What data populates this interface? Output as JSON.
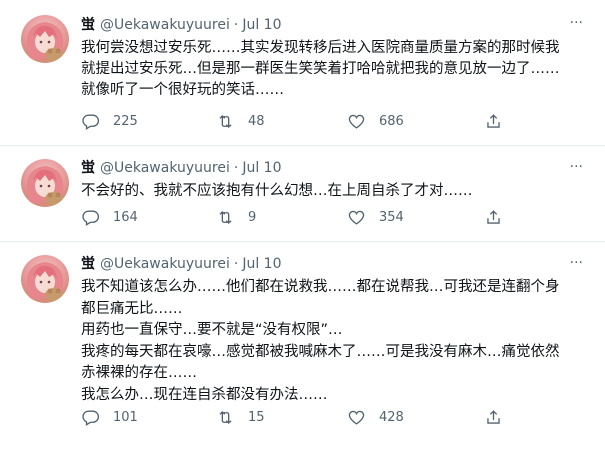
{
  "tweets": [
    {
      "name": "蛍",
      "handle": "@Uekawakuyuurei",
      "dot": "·",
      "date": "Jul 10",
      "more": "···",
      "text": "我何尝没想过安乐死……其实发现转移后进入医院商量质量方案的那时候我\n就提出过安乐死…但是那一群医生笑笑着打哈哈就把我的意见放一边了……\n就像听了一个很好玩的笑话……",
      "replies": "225",
      "retweets": "48",
      "likes": "686"
    },
    {
      "name": "蛍",
      "handle": "@Uekawakuyuurei",
      "dot": "·",
      "date": "Jul 10",
      "more": "···",
      "text": "不会好的、我就不应该抱有什么幻想…在上周自杀了才对……",
      "replies": "164",
      "retweets": "9",
      "likes": "354"
    },
    {
      "name": "蛍",
      "handle": "@Uekawakuyuurei",
      "dot": "·",
      "date": "Jul 10",
      "more": "···",
      "text": "我不知道该怎么办……他们都在说救我……都在说帮我…可我还是连翻个身\n都巨痛无比……\n用药也一直保守…要不就是“没有权限”…\n我疼的每天都在哀嚎…感觉都被我喊麻木了……可是我没有麻木…痛觉依然\n赤裸裸的存在……\n我怎么办…现在连自杀都没有办法……",
      "replies": "101",
      "retweets": "15",
      "likes": "428"
    }
  ],
  "icons": {
    "reply": "reply-icon",
    "retweet": "retweet-icon",
    "like": "heart-icon",
    "share": "share-icon",
    "more": "more-icon"
  },
  "colors": {
    "text": "#0f1419",
    "secondary": "#536471",
    "divider": "#e6ecf0",
    "avatar": "#e89fa0"
  }
}
